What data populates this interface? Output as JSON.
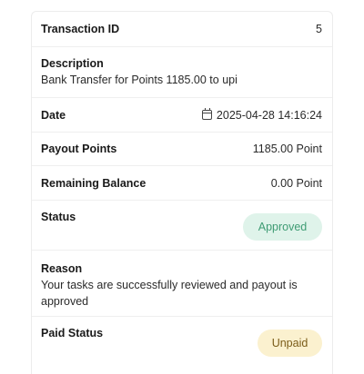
{
  "transaction": {
    "id_label": "Transaction ID",
    "id_value": "5",
    "description_label": "Description",
    "description_value": "Bank Transfer for Points 1185.00 to upi",
    "date_label": "Date",
    "date_value": "2025-04-28 14:16:24",
    "payout_label": "Payout Points",
    "payout_value": "1185.00 Point",
    "balance_label": "Remaining Balance",
    "balance_value": "0.00 Point",
    "status_label": "Status",
    "status_value": "Approved",
    "reason_label": "Reason",
    "reason_value": "Your tasks are successfully reviewed and payout is approved",
    "paid_label": "Paid Status",
    "paid_value": "Unpaid"
  },
  "icons": {
    "date": "calendar-icon"
  },
  "colors": {
    "approved_bg": "#dff3ea",
    "approved_text": "#3f9c74",
    "unpaid_bg": "#fbf1cf",
    "unpaid_text": "#7a5c18"
  }
}
